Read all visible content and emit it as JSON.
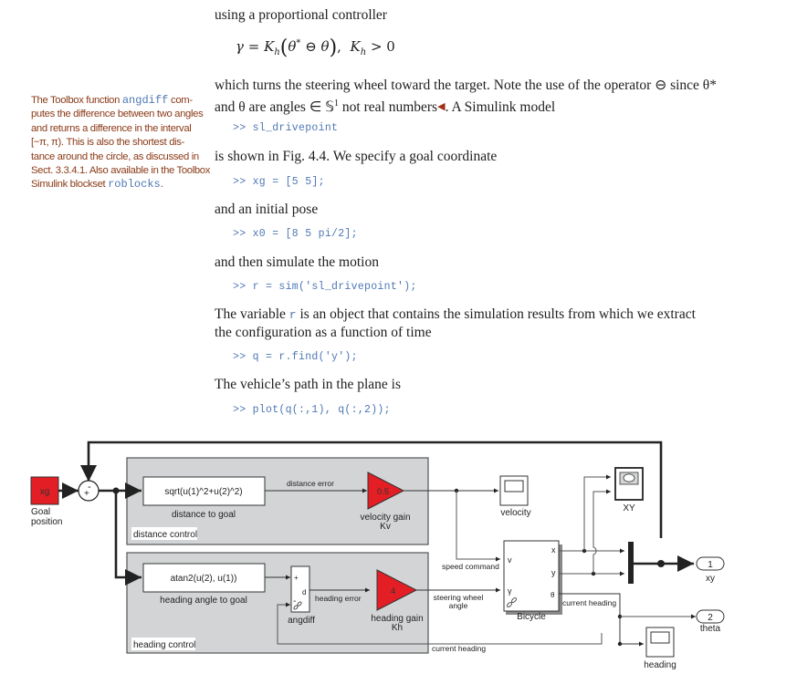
{
  "text": {
    "p1": "using a proportional controller",
    "eq": {
      "lhs": "γ",
      "eq_sign": "=",
      "gain": "K",
      "gain_sub": "h",
      "theta_star": "θ",
      "star": "*",
      "op": "⊖",
      "theta": "θ",
      "cond_gain": "K",
      "cond_sub": "h",
      "cond_rhs": "> 0"
    },
    "p2_line1": "which turns the steering wheel toward the target. Note the use of the operator ⊖ since θ*",
    "p2_line2_a": "and θ are angles ∈ 𝕊",
    "p2_line2_sup": "1",
    "p2_line2_b": " not real numbers",
    "p2_marker": "◀",
    "p2_line2_c": ". A Simulink model",
    "code1": ">> sl_drivepoint",
    "p3": "is shown in Fig. 4.4. We specify a goal coordinate",
    "code2": ">> xg = [5 5];",
    "p4": "and an initial pose",
    "code3": ">> x0 = [8 5 pi/2];",
    "p5": "and then simulate the motion",
    "code4": ">> r = sim('sl_drivepoint');",
    "p6_a": "The variable ",
    "p6_code": "r",
    "p6_b": " is an object that contains the simulation results from which we extract",
    "p6_line2": "the configuration as a function of time",
    "code5": ">> q = r.find('y');",
    "p7": "The vehicle’s path in the plane is",
    "code6": ">> plot(q(:,1), q(:,2));"
  },
  "margin_note": {
    "l1_a": "The Toolbox function ",
    "l1_code": "angdiff",
    "l1_b": " com-",
    "l2": "putes the difference between two angles",
    "l3": "and returns a difference in the interval",
    "l4": "[−π, π). This is also the shortest dis-",
    "l5": "tance around the circle, as discussed in",
    "l6": "Sect. 3.3.4.1. Also available in the Toolbox",
    "l7_a": "Simulink blockset ",
    "l7_code": "roblocks",
    "l7_b": "."
  },
  "diagram": {
    "colors": {
      "gain_fill": "#e31e24",
      "subsystem_fill": "#d3d4d6",
      "wire": "#222222",
      "wire_gray": "#555555"
    },
    "goal_block": {
      "value": "xg",
      "label_line1": "Goal",
      "label_line2": "position"
    },
    "sum_block": {
      "signs": [
        "+",
        "-"
      ]
    },
    "distance_subsystem": {
      "label": "distance control",
      "fcn_expr": "sqrt(u(1)^2+u(2)^2)",
      "fcn_label": "distance to goal",
      "signal": "distance error",
      "gain_value": "0.5",
      "gain_label_line1": "velocity gain",
      "gain_label_line2": "Kv"
    },
    "heading_subsystem": {
      "label": "heading control",
      "fcn_expr": "atan2(u(2), u(1))",
      "fcn_label": "heading angle to goal",
      "angdiff_label": "angdiff",
      "angdiff_ports": [
        "+",
        "d",
        "-"
      ],
      "signal": "heading error",
      "gain_value": "4",
      "gain_label_line1": "heading gain",
      "gain_label_line2": "Kh"
    },
    "velocity_scope": {
      "label": "velocity"
    },
    "xy_scope": {
      "label": "XY"
    },
    "heading_scope": {
      "label": "heading"
    },
    "bicycle": {
      "label": "Bicycle",
      "inputs": [
        "v",
        "γ"
      ],
      "outputs": [
        "x",
        "y",
        "θ"
      ]
    },
    "signals": {
      "speed_command": "speed command",
      "steering_line1": "steering wheel",
      "steering_line2": "angle",
      "current_heading": "current heading",
      "current_heading_out": "current heading"
    },
    "outports": [
      {
        "number": "1",
        "label": "xy"
      },
      {
        "number": "2",
        "label": "theta"
      }
    ]
  }
}
